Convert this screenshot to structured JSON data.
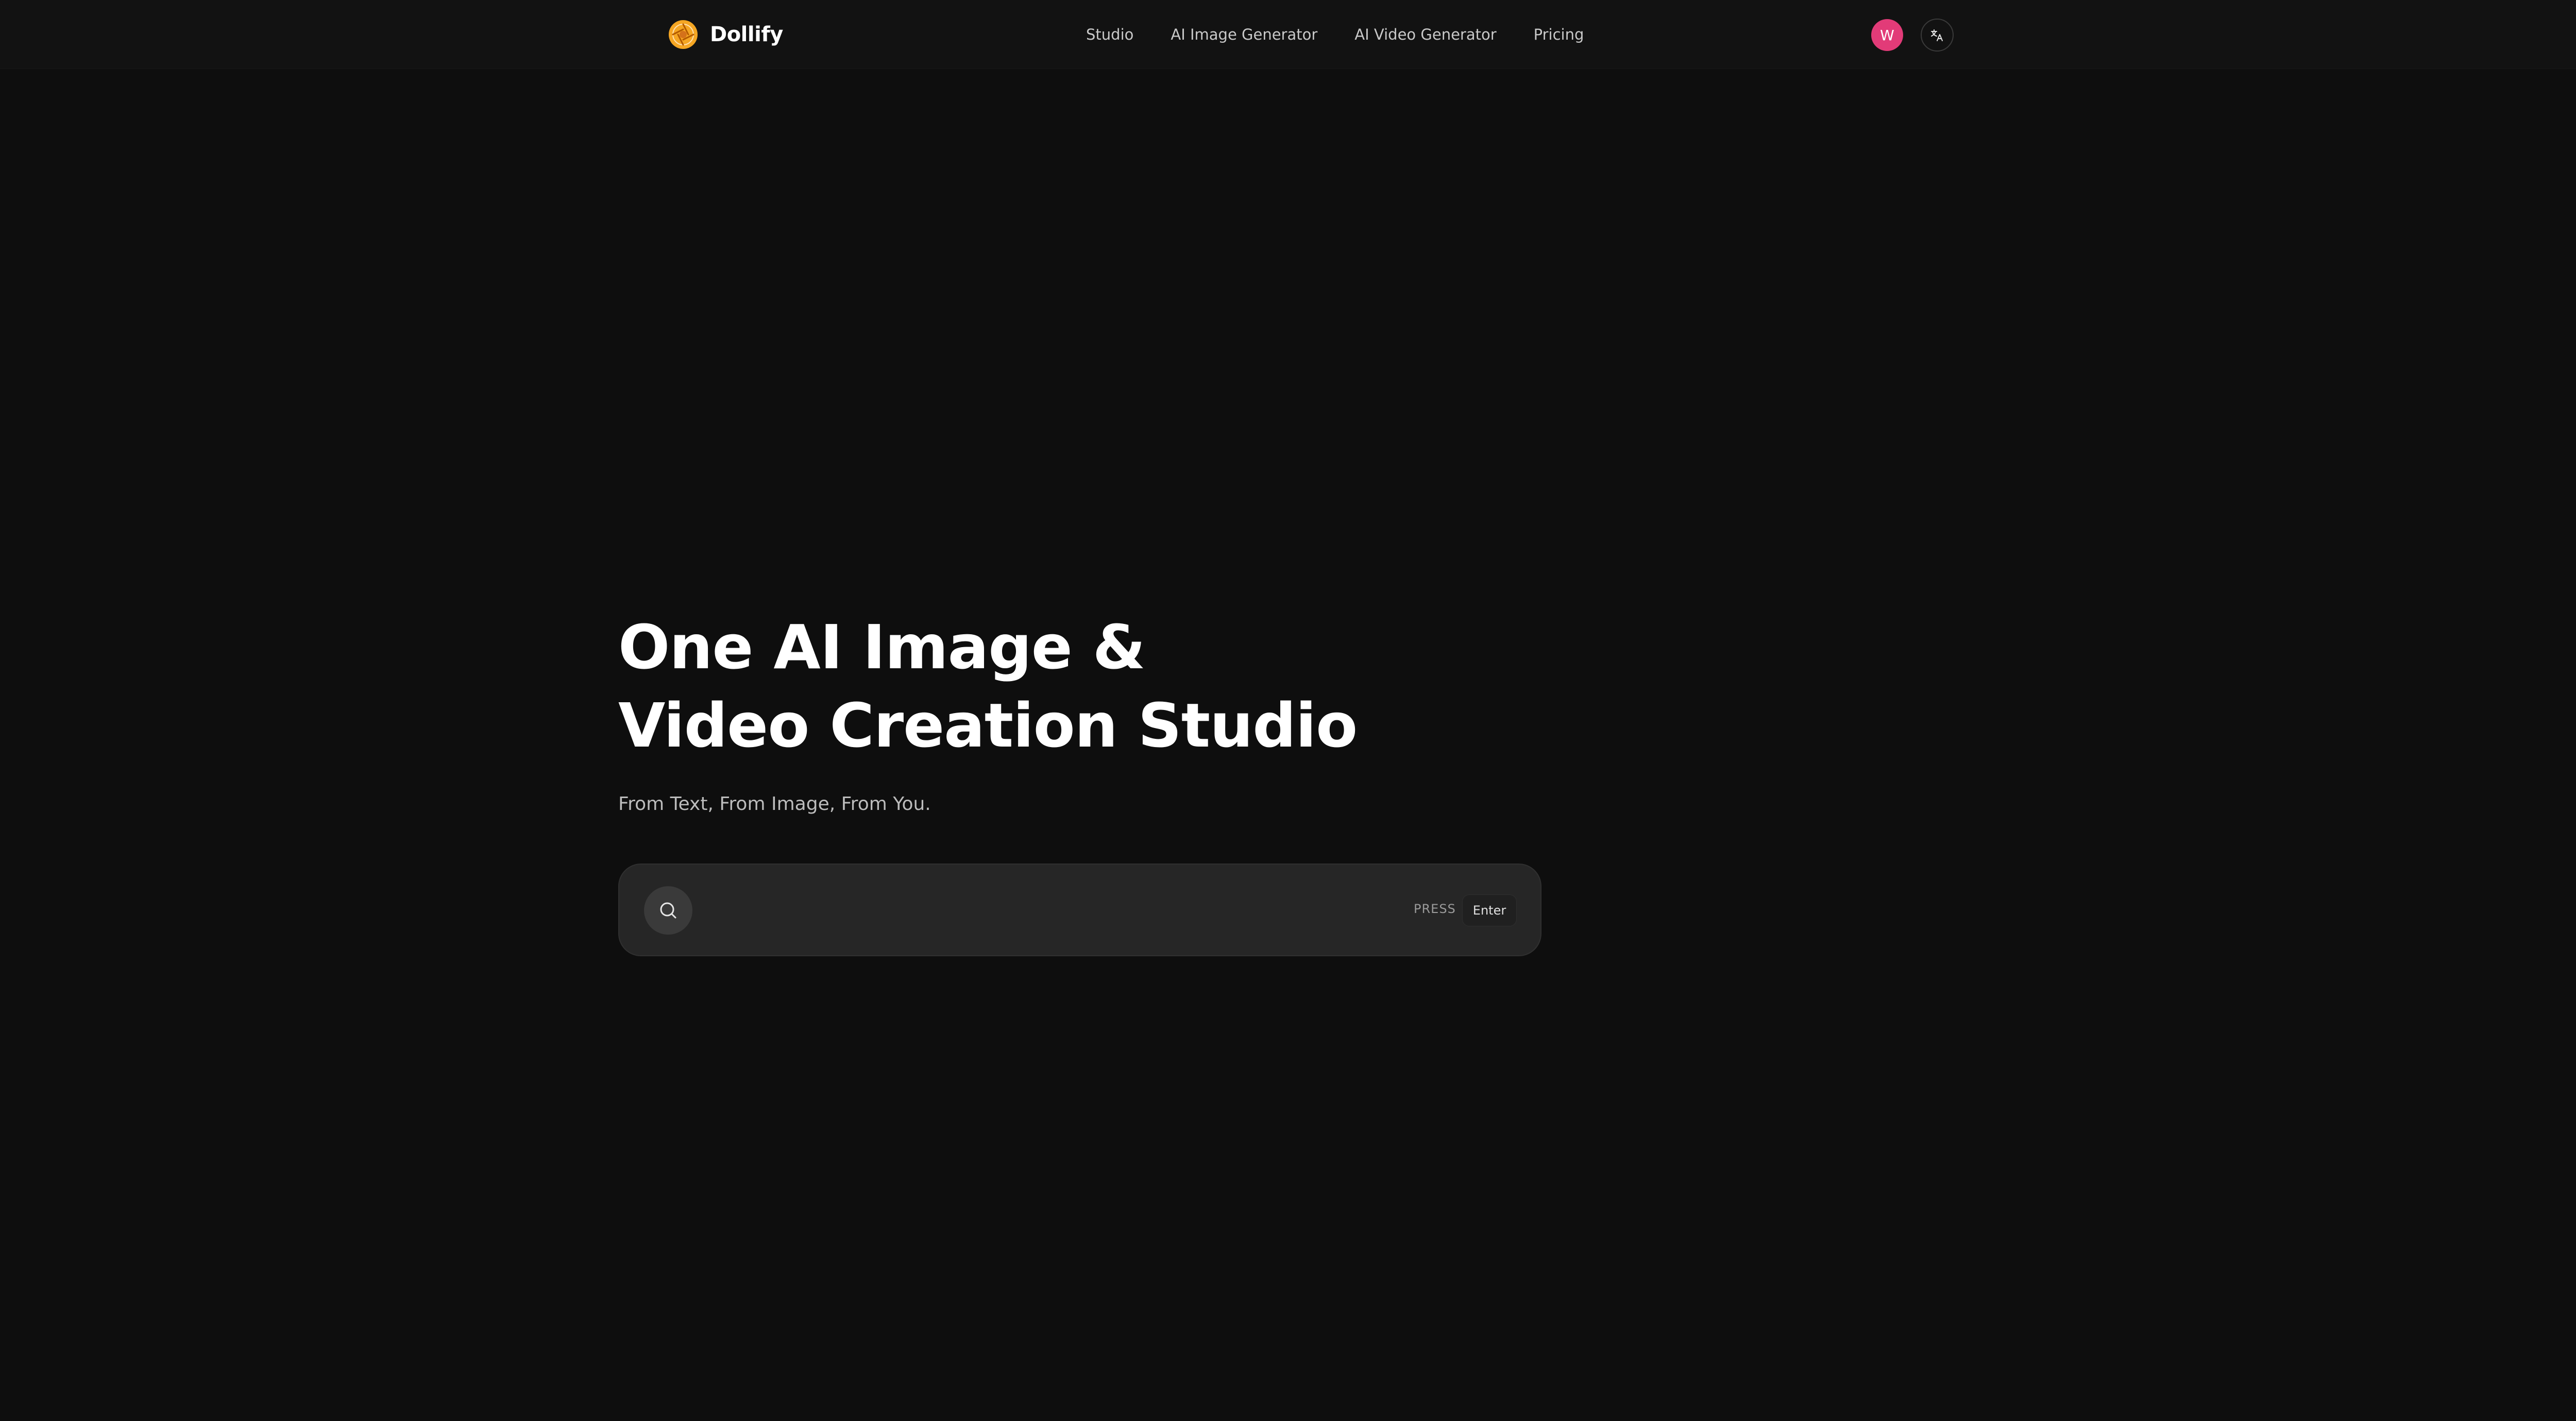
{
  "header": {
    "brand": "Dollify",
    "nav": [
      {
        "label": "Studio"
      },
      {
        "label": "AI Image Generator"
      },
      {
        "label": "AI Video Generator"
      },
      {
        "label": "Pricing"
      }
    ],
    "avatar_initial": "W",
    "icons": {
      "logo": "orange-aperture-logo-icon",
      "language": "translate-icon"
    }
  },
  "hero": {
    "title_line1": "One AI Image &",
    "title_line2": "Video Creation Studio",
    "subtitle": "From Text, From Image, From You."
  },
  "search": {
    "value": "",
    "placeholder": "",
    "press_label": "PRESS",
    "key_label": "Enter",
    "icon": "search-icon"
  },
  "colors": {
    "background": "#0e0e0e",
    "header": "#121212",
    "avatar": "#e23b78",
    "logo": "#f5a623",
    "search_box": "#262626"
  }
}
